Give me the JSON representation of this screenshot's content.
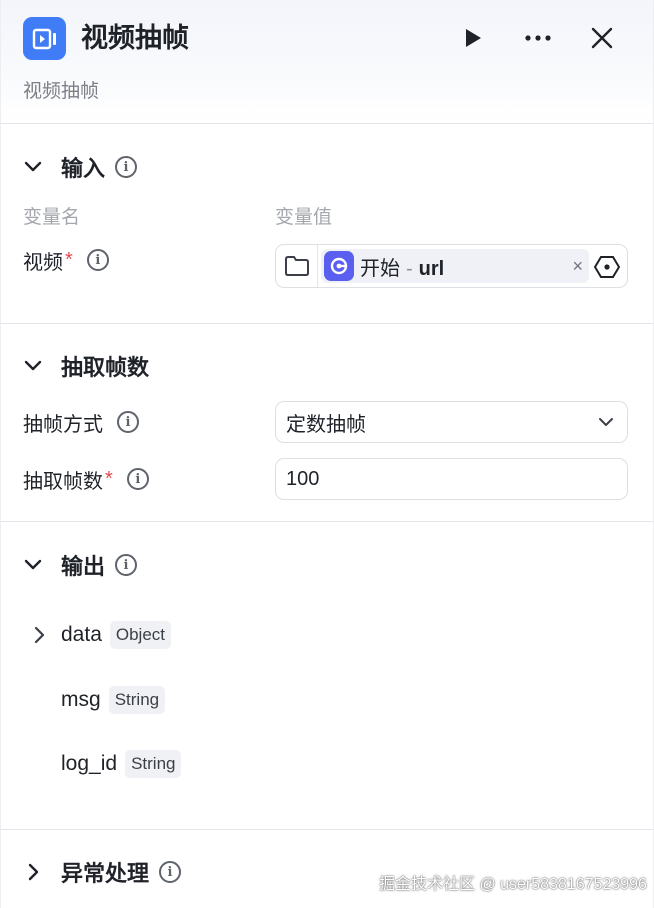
{
  "header": {
    "app_icon": "video-frame-icon",
    "title": "视频抽帧",
    "subtitle": "视频抽帧",
    "actions": [
      "play-icon",
      "more-icon",
      "close-icon"
    ]
  },
  "input_section": {
    "title": "输入",
    "col_name": "变量名",
    "col_value": "变量值",
    "rows": [
      {
        "label": "视频",
        "required": "*",
        "ref_node": "开始",
        "ref_sep": "-",
        "ref_var": "url",
        "clear": "×"
      }
    ]
  },
  "extract_section": {
    "title": "抽取帧数",
    "mode_label": "抽帧方式",
    "mode_value": "定数抽帧",
    "count_label": "抽取帧数",
    "count_required": "*",
    "count_value": "100"
  },
  "output_section": {
    "title": "输出",
    "items": [
      {
        "name": "data",
        "type": "Object",
        "expandable": true
      },
      {
        "name": "msg",
        "type": "String",
        "expandable": false
      },
      {
        "name": "log_id",
        "type": "String",
        "expandable": false
      }
    ]
  },
  "exception_section": {
    "title": "异常处理"
  },
  "watermark": "掘金技术社区 @ user5838167523996",
  "colors": {
    "accent": "#3f7cf6",
    "node_chip": "#5a5ff0",
    "required": "#e5484d"
  }
}
